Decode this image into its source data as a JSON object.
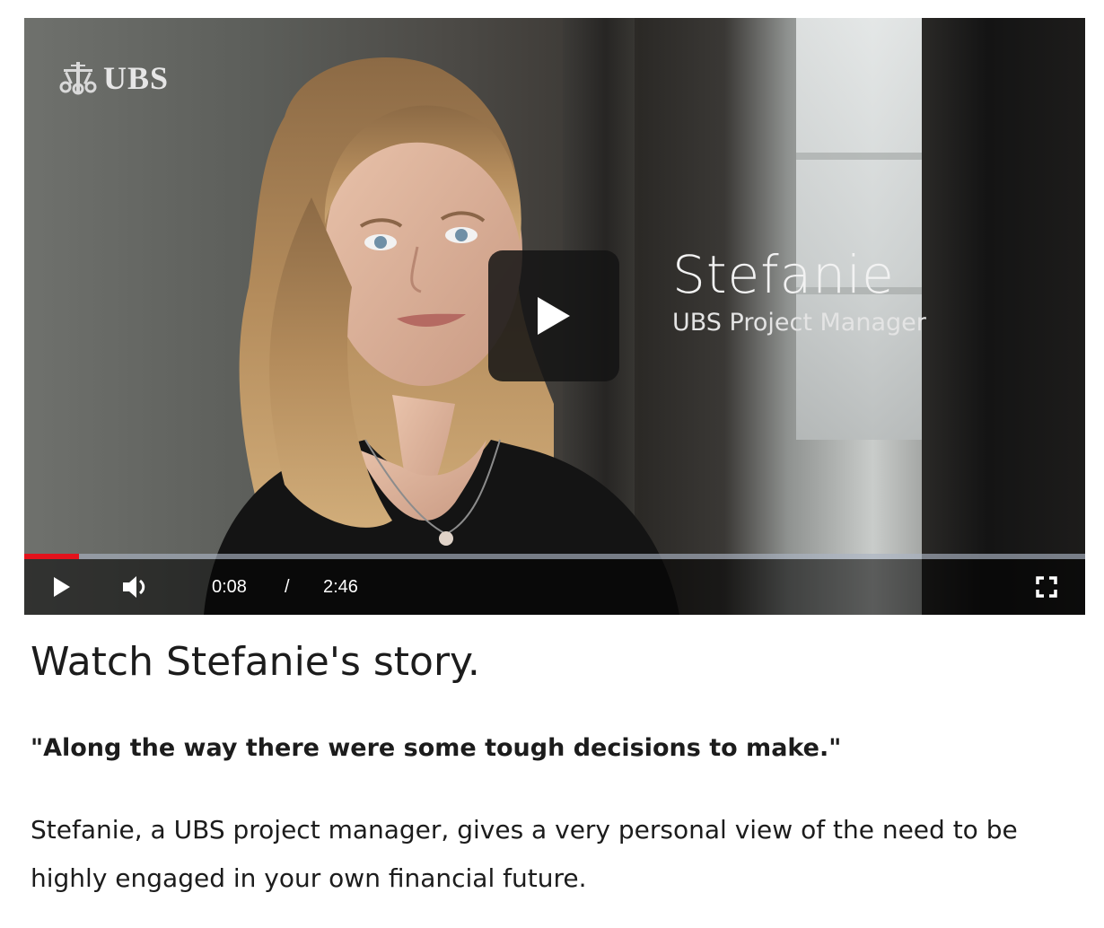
{
  "video": {
    "logo_text": "UBS",
    "overlay_name": "Stefanie",
    "overlay_role": "UBS Project Manager",
    "current_time": "0:08",
    "time_separator": "/",
    "duration": "2:46",
    "progress_fraction": 0.052,
    "progress_color": "#e3121c",
    "icons": {
      "big_play": "play-icon",
      "play": "play-icon",
      "volume": "volume-icon",
      "fullscreen": "fullscreen-icon",
      "logo": "ubs-keys-logo"
    }
  },
  "article": {
    "headline": "Watch Stefanie's story.",
    "quote": "\"Along the way there were some tough decisions to make.\"",
    "description": "Stefanie, a UBS project manager, gives a very personal view of the need to be highly engaged in your own financial future."
  }
}
